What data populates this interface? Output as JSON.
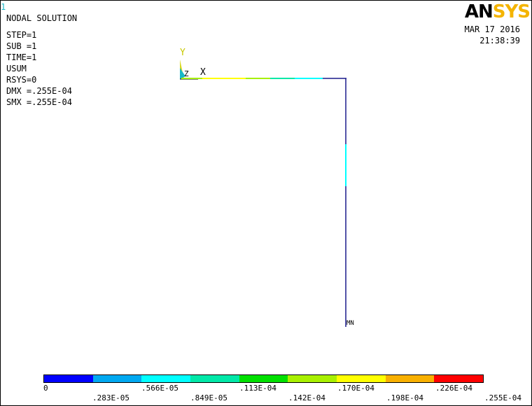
{
  "window_number": "1",
  "plot_info": {
    "title": "NODAL SOLUTION",
    "lines": [
      "STEP=1",
      "SUB =1",
      "TIME=1",
      "USUM",
      "RSYS=0",
      "DMX =.255E-04",
      "SMX =.255E-04"
    ]
  },
  "logo": {
    "part1": "AN",
    "part2": "SYS"
  },
  "datetime": {
    "date": "MAR 17 2016",
    "time": "21:38:39"
  },
  "triad": {
    "y_label": "Y",
    "z_label": "Z",
    "x_label": "X"
  },
  "model": {
    "mn_label": "MN"
  },
  "colors": {
    "accent_logo": "#f4b400",
    "triad_y": "#d8d820",
    "triad_z": "#18b8c8",
    "element_line": "#1a1a8c"
  },
  "legend": {
    "colors": [
      "#0000ff",
      "#00a8f0",
      "#00ffff",
      "#00e8a8",
      "#00e000",
      "#a8f000",
      "#ffff00",
      "#f8b000",
      "#ff0000"
    ],
    "labels_top": [
      "0",
      ".566E-05",
      ".113E-04",
      ".170E-04",
      ".226E-04"
    ],
    "labels_bottom": [
      ".283E-05",
      ".849E-05",
      ".142E-04",
      ".198E-04",
      ".255E-04"
    ]
  }
}
